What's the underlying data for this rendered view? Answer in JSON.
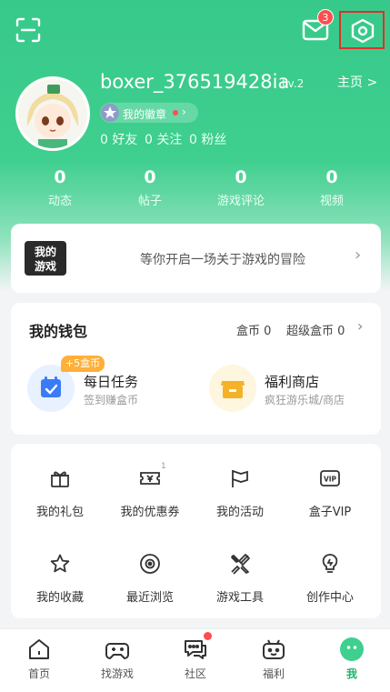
{
  "header": {
    "mail_badge": "3",
    "username": "boxer_376519428ia",
    "level": "Lv.2",
    "homepage_link": "主页 >",
    "badge_label": "我的徽章",
    "friends": "0 好友",
    "follows": "0 关注",
    "fans": "0 粉丝",
    "accent_color": "#3fcf8f"
  },
  "stats": [
    {
      "value": "0",
      "label": "动态"
    },
    {
      "value": "0",
      "label": "帖子"
    },
    {
      "value": "0",
      "label": "游戏评论"
    },
    {
      "value": "0",
      "label": "视频"
    }
  ],
  "banner": {
    "logo_text": "我的游戏",
    "text": "等你开启一场关于游戏的冒险"
  },
  "wallet": {
    "title": "我的钱包",
    "box_coins": "盒币 0",
    "super_coins": "超级盒币 0",
    "task_tag": "+5盒币",
    "task_title": "每日任务",
    "task_sub": "签到赚盒币",
    "shop_title": "福利商店",
    "shop_sub": "疯狂游乐城/商店"
  },
  "grid": {
    "coupon_count": "1",
    "items": [
      {
        "label": "我的礼包",
        "icon": "gift-icon"
      },
      {
        "label": "我的优惠券",
        "icon": "coupon-icon"
      },
      {
        "label": "我的活动",
        "icon": "flag-icon"
      },
      {
        "label": "盒子VIP",
        "icon": "vip-icon"
      },
      {
        "label": "我的收藏",
        "icon": "star-icon"
      },
      {
        "label": "最近浏览",
        "icon": "eye-icon"
      },
      {
        "label": "游戏工具",
        "icon": "tools-icon"
      },
      {
        "label": "创作中心",
        "icon": "bulb-icon"
      }
    ]
  },
  "tabbar": [
    {
      "label": "首页",
      "icon": "home-icon"
    },
    {
      "label": "找游戏",
      "icon": "gamepad-icon"
    },
    {
      "label": "社区",
      "icon": "chat-icon"
    },
    {
      "label": "福利",
      "icon": "gift-bot-icon"
    },
    {
      "label": "我",
      "icon": "me-icon",
      "active": true
    }
  ]
}
